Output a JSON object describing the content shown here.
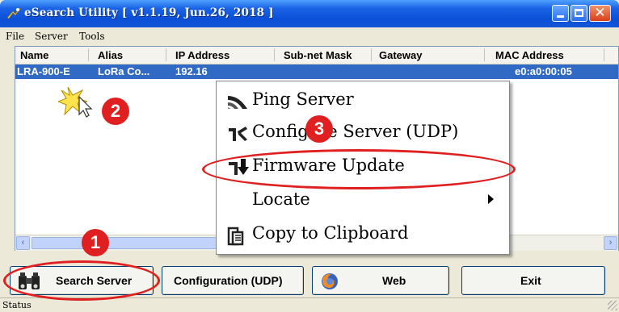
{
  "window": {
    "title": "eSearch Utility [ v1.1.19, Jun.26, 2018 ]"
  },
  "menu": {
    "file": "File",
    "server": "Server",
    "tools": "Tools"
  },
  "columns": [
    "Name",
    "Alias",
    "IP Address",
    "Sub-net Mask",
    "Gateway",
    "MAC Address"
  ],
  "row": {
    "name": "LRA-900-E",
    "alias": "LoRa Co...",
    "ip": "192.16",
    "mac": "e0:a0:00:05"
  },
  "context_menu": {
    "items": [
      {
        "label": "Ping Server",
        "icon": "ping-icon"
      },
      {
        "label": "Configure Server (UDP)",
        "icon": "configure-icon"
      },
      {
        "label": "Firmware Update",
        "icon": "firmware-update-icon"
      },
      {
        "label": "Locate",
        "icon": "submenu-arrow-icon"
      },
      {
        "label": "Copy to Clipboard",
        "icon": "clipboard-icon"
      }
    ]
  },
  "buttons": {
    "search": "Search Server",
    "configuration": "Configuration (UDP)",
    "web": "Web",
    "exit": "Exit"
  },
  "status": "Status",
  "badges": {
    "one": "1",
    "two": "2",
    "three": "3"
  },
  "colors": {
    "selection": "#316ac5",
    "annotation": "#e02020",
    "titlebar": "#0a4fd6"
  }
}
